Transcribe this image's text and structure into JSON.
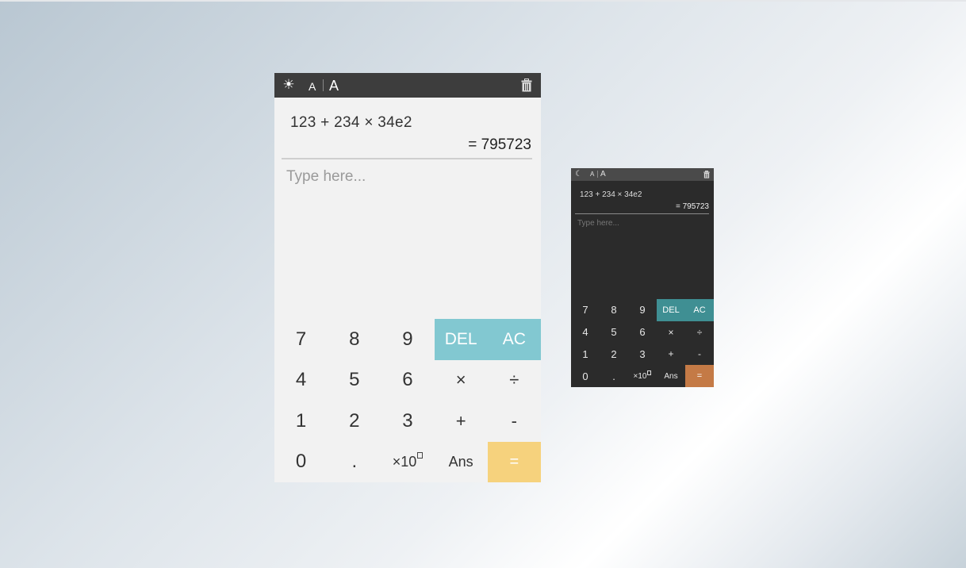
{
  "light": {
    "toolbar": {
      "theme_icon": "sun-icon",
      "font_small_label": "A",
      "font_large_label": "A",
      "trash_icon": "trash-icon"
    },
    "expression": "123 + 234 × 34e2",
    "result": "= 795723",
    "input_placeholder": "Type here...",
    "colors": {
      "toolbar": "#3d3d3d",
      "del_ac": "#82c8d1",
      "equals": "#f6d27d",
      "background": "#f2f2f2"
    }
  },
  "dark": {
    "toolbar": {
      "theme_icon": "moon-icon",
      "font_small_label": "A",
      "font_large_label": "A",
      "trash_icon": "trash-icon"
    },
    "expression": "123 + 234 × 34e2",
    "result": "= 795723",
    "input_placeholder": "Type here...",
    "colors": {
      "toolbar": "#4a4a4a",
      "del_ac": "#3f8f93",
      "equals": "#c47a46",
      "background": "#2b2b2b"
    }
  },
  "keys": {
    "k7": "7",
    "k8": "8",
    "k9": "9",
    "del": "DEL",
    "ac": "AC",
    "k4": "4",
    "k5": "5",
    "k6": "6",
    "mul": "×",
    "div": "÷",
    "k1": "1",
    "k2": "2",
    "k3": "3",
    "add": "+",
    "sub": "-",
    "k0": "0",
    "dot": ".",
    "exp": "×10",
    "ans": "Ans",
    "eq": "="
  }
}
